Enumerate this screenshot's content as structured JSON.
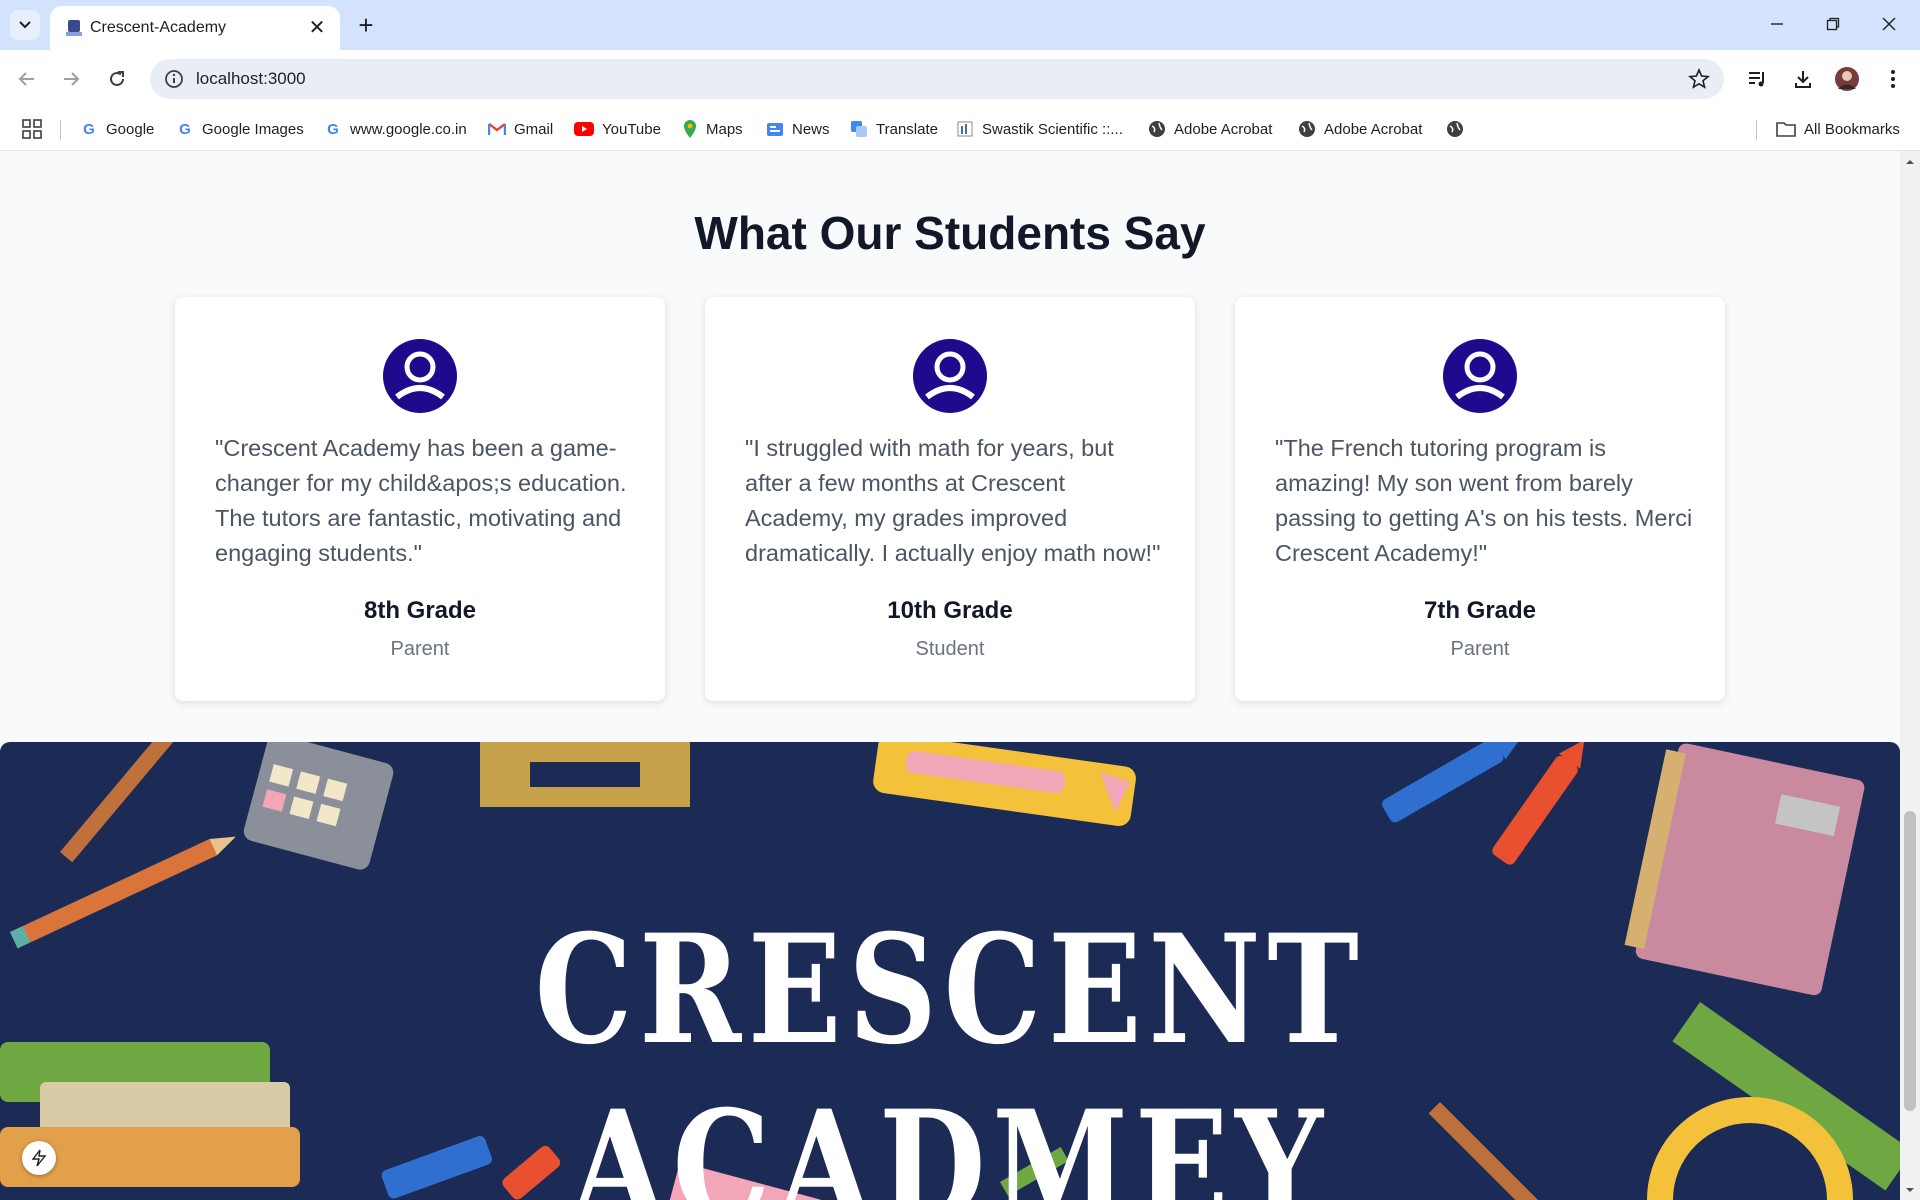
{
  "browser": {
    "tab_title": "Crescent-Academy",
    "url": "localhost:3000",
    "bookmarks": [
      {
        "label": "Google",
        "icon": "google-icon"
      },
      {
        "label": "Google Images",
        "icon": "google-icon"
      },
      {
        "label": "www.google.co.in",
        "icon": "google-icon"
      },
      {
        "label": "Gmail",
        "icon": "gmail-icon"
      },
      {
        "label": "YouTube",
        "icon": "youtube-icon"
      },
      {
        "label": "Maps",
        "icon": "maps-icon"
      },
      {
        "label": "News",
        "icon": "news-icon"
      },
      {
        "label": "Translate",
        "icon": "translate-icon"
      },
      {
        "label": "Swastik Scientific ::...",
        "icon": "site-icon"
      },
      {
        "label": "Adobe Acrobat",
        "icon": "globe-icon"
      },
      {
        "label": "Adobe Acrobat",
        "icon": "globe-icon"
      }
    ],
    "all_bookmarks": "All Bookmarks"
  },
  "testimonials": {
    "title": "What Our Students Say",
    "cards": [
      {
        "quote": "\"Crescent Academy has been a game-changer for my child&apos;s education. The tutors are fantastic, motivating and engaging students.\"",
        "grade": "8th Grade",
        "role": "Parent"
      },
      {
        "quote": "\"I struggled with math for years, but after a few months at Crescent Academy, my grades improved dramatically. I actually enjoy math now!\"",
        "grade": "10th Grade",
        "role": "Student"
      },
      {
        "quote": "\"The French tutoring program is amazing! My son went from barely passing to getting A's on his tests. Merci Crescent Academy!\"",
        "grade": "7th Grade",
        "role": "Parent"
      }
    ]
  },
  "banner": {
    "title": "CRESCENT ACADMEY"
  },
  "colors": {
    "avatar": "#1e0a8c",
    "banner_bg": "#1c2b55"
  }
}
